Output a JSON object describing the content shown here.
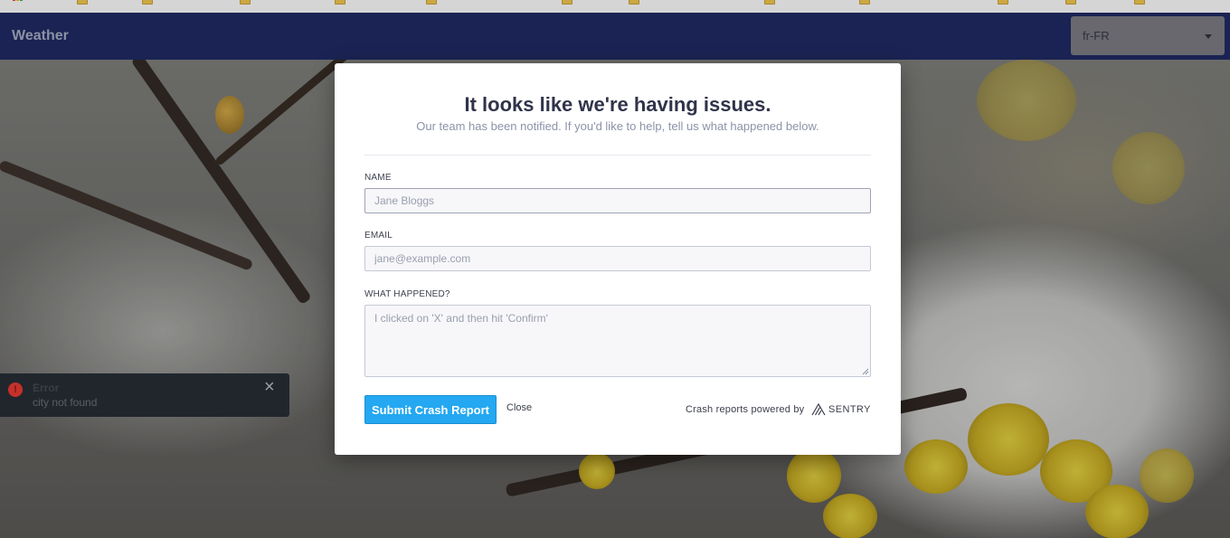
{
  "app": {
    "title": "Weather",
    "locale_select": {
      "value": "fr-FR"
    }
  },
  "toast": {
    "title": "Error",
    "message": "city not found",
    "close_label": "×"
  },
  "crash_dialog": {
    "title": "It looks like we're having issues.",
    "subtitle": "Our team has been notified. If you'd like to help, tell us what happened below.",
    "name": {
      "label": "NAME",
      "value": "",
      "placeholder": "Jane Bloggs"
    },
    "email": {
      "label": "EMAIL",
      "value": "",
      "placeholder": "jane@example.com"
    },
    "comments": {
      "label": "WHAT HAPPENED?",
      "value": "",
      "placeholder": "I clicked on 'X' and then hit 'Confirm'"
    },
    "submit_label": "Submit Crash Report",
    "close_label": "Close",
    "powered_by": "Crash reports powered by",
    "brand": "SENTRY"
  },
  "colors": {
    "header_bg": "#1b2660",
    "submit_bg": "#23a8f1",
    "toast_bg": "#21262d",
    "error_icon": "#c5312a"
  },
  "icons": {
    "toast": "error-icon",
    "toast_close": "close-icon",
    "locale_caret": "caret-down-icon",
    "brand": "sentry-logo-icon"
  }
}
